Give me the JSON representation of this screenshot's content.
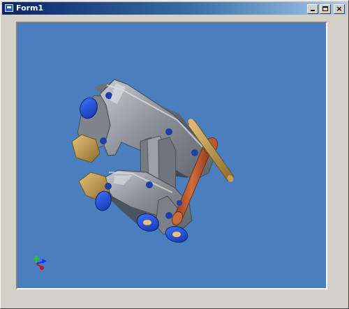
{
  "window": {
    "title": "Form1",
    "icon": "form-app-icon",
    "buttons": {
      "minimize": "minimize-icon",
      "maximize": "maximize-icon",
      "close": "close-icon"
    }
  },
  "viewport": {
    "background_color": "#4a7fbf",
    "model": "3d-clamp-assembly",
    "triad": "xyz-axis-triad-icon"
  }
}
